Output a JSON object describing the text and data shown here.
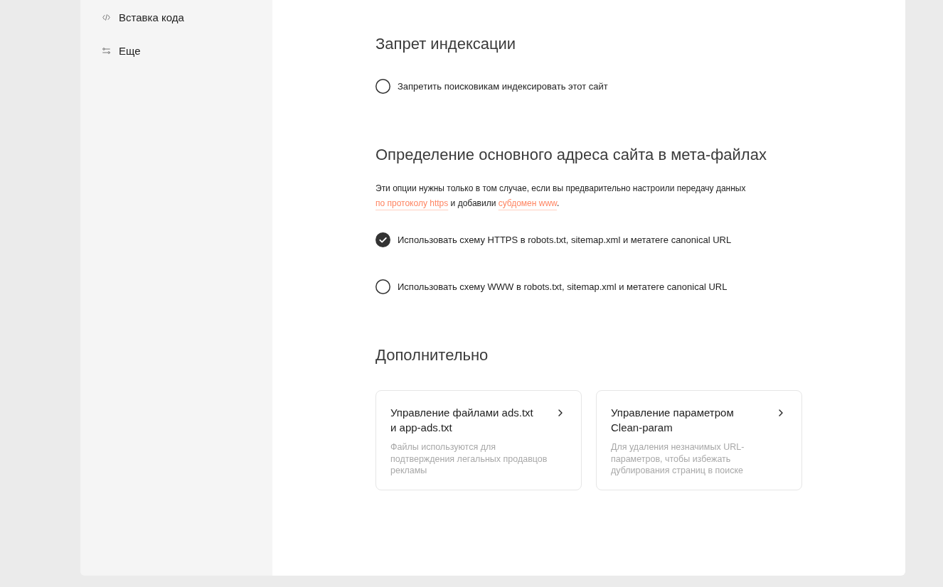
{
  "sidebar": {
    "items": [
      {
        "kind": "code",
        "label": "Вставка кода"
      },
      {
        "kind": "options",
        "label": "Еще"
      }
    ]
  },
  "sections": [
    {
      "kind": "options",
      "heading": "Запрет индексации",
      "options": [
        {
          "label": "Запретить поисковикам индексировать этот сайт",
          "checked": false
        }
      ]
    },
    {
      "kind": "options",
      "heading": "Определение основного адреса сайта в мета-файлах",
      "note": [
        {
          "kind": "text",
          "text": "Эти опции нужны только в том случае, если вы предварительно настроили передачу данных "
        },
        {
          "kind": "link",
          "text": "по протоколу https"
        },
        {
          "kind": "text",
          "text": " и добавили "
        },
        {
          "kind": "link",
          "text": "субдомен www"
        },
        {
          "kind": "text",
          "text": "."
        }
      ],
      "options": [
        {
          "label": "Использовать схему HTTPS в robots.txt, sitemap.xml и метатеге canonical URL",
          "checked": true
        },
        {
          "label": "Использовать схему WWW в robots.txt, sitemap.xml и метатеге canonical URL",
          "checked": false
        }
      ]
    },
    {
      "kind": "cards",
      "heading": "Дополнительно",
      "cards": [
        {
          "title": "Управление файлами ads.txt и app-ads.txt",
          "description": "Файлы используются для подтверждения легальных продавцов рекламы"
        },
        {
          "title": "Управление параметром Clean-param",
          "description": "Для удаления незначимых URL-параметров, чтобы избежать дублирования страниц в поиске"
        }
      ]
    }
  ]
}
